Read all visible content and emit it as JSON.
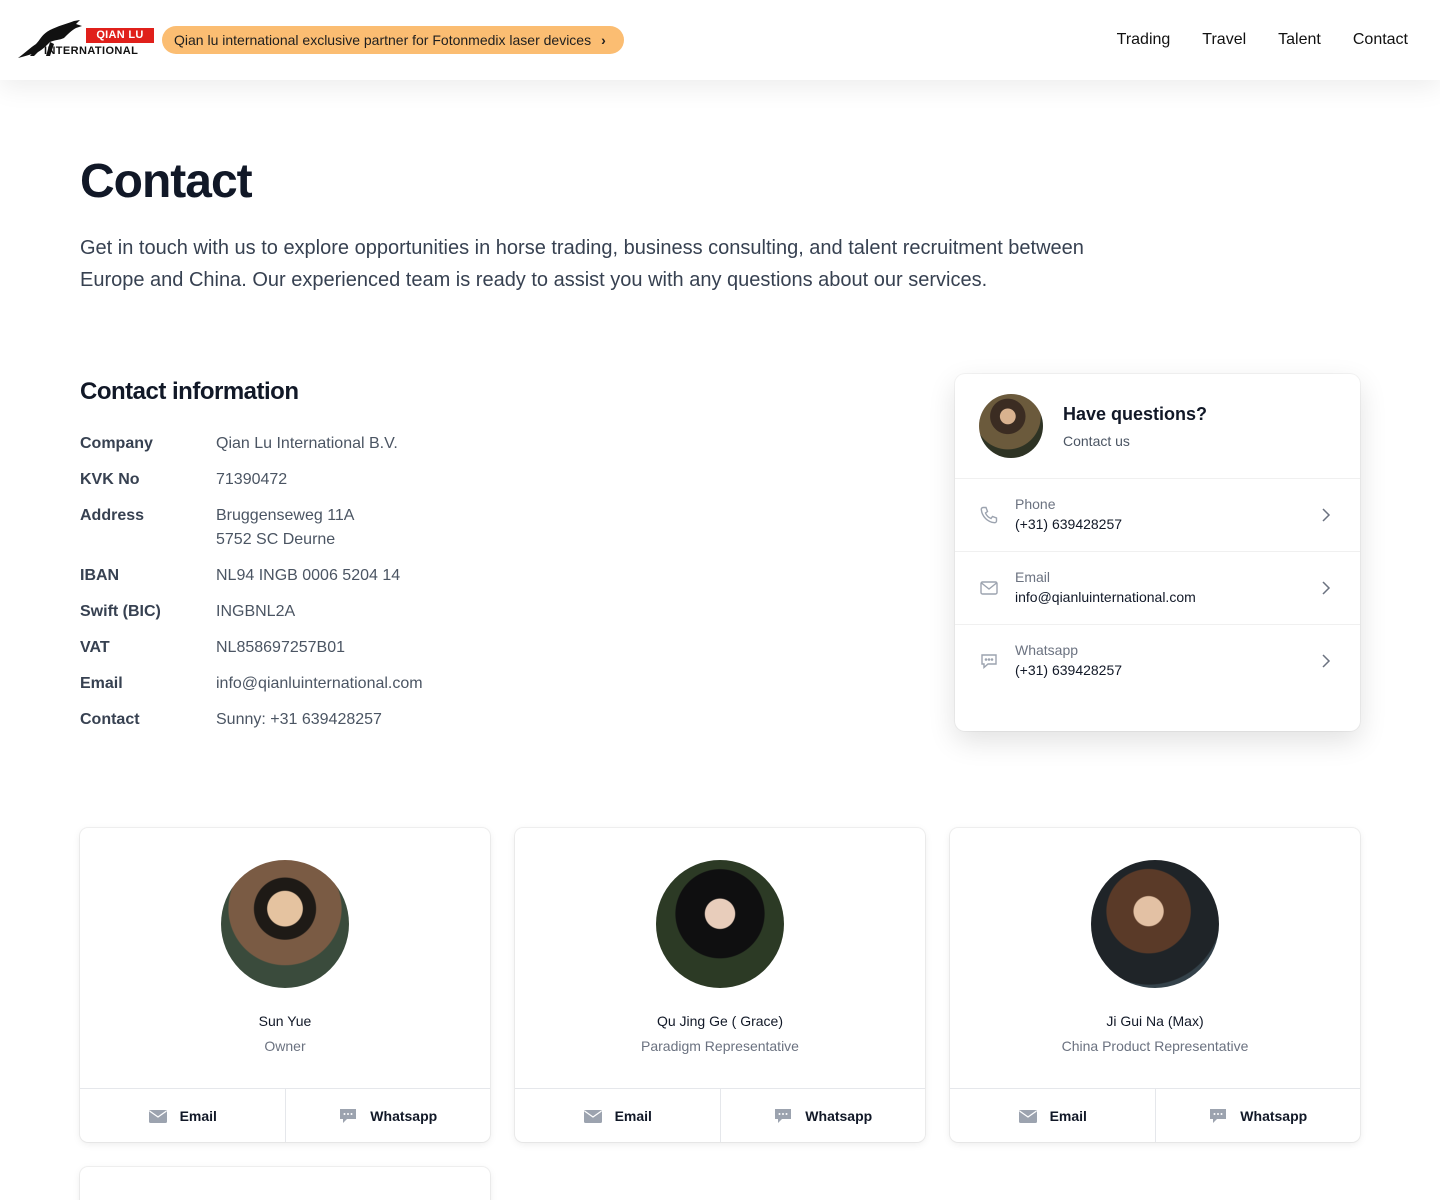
{
  "header": {
    "logo_top": "QIAN LU",
    "logo_bottom": "INTERNATIONAL",
    "promo": "Qian lu international exclusive partner for Fotonmedix laser devices",
    "nav": [
      "Trading",
      "Travel",
      "Talent",
      "Contact"
    ]
  },
  "hero": {
    "title": "Contact",
    "intro": "Get in touch with us to explore opportunities in horse trading, business consulting, and talent recruitment between Europe and China. Our experienced team is ready to assist you with any questions about our services."
  },
  "contact_info": {
    "title": "Contact information",
    "rows": [
      {
        "label": "Company",
        "value": "Qian Lu International B.V.",
        "value2": ""
      },
      {
        "label": "KVK No",
        "value": "71390472",
        "value2": ""
      },
      {
        "label": "Address",
        "value": "Bruggenseweg 11A",
        "value2": "5752 SC Deurne"
      },
      {
        "label": "IBAN",
        "value": "NL94 INGB 0006 5204 14",
        "value2": ""
      },
      {
        "label": "Swift (BIC)",
        "value": "INGBNL2A",
        "value2": ""
      },
      {
        "label": "VAT",
        "value": "NL858697257B01",
        "value2": ""
      },
      {
        "label": "Email",
        "value": "info@qianluinternational.com",
        "value2": ""
      },
      {
        "label": "Contact",
        "value": "Sunny: +31 639428257",
        "value2": ""
      }
    ]
  },
  "question_card": {
    "title": "Have questions?",
    "subtitle": "Contact us",
    "items": [
      {
        "icon": "phone-icon",
        "label": "Phone",
        "value": "(+31) 639428257"
      },
      {
        "icon": "mail-icon",
        "label": "Email",
        "value": "info@qianluinternational.com"
      },
      {
        "icon": "chat-icon",
        "label": "Whatsapp",
        "value": "(+31) 639428257"
      }
    ]
  },
  "team": [
    {
      "name": "Sun Yue",
      "role": "Owner",
      "email_label": "Email",
      "whatsapp_label": "Whatsapp"
    },
    {
      "name": "Qu Jing Ge ( Grace)",
      "role": "Paradigm Representative",
      "email_label": "Email",
      "whatsapp_label": "Whatsapp"
    },
    {
      "name": "Ji Gui Na (Max)",
      "role": "China Product Representative",
      "email_label": "Email",
      "whatsapp_label": "Whatsapp"
    }
  ],
  "colors": {
    "promo_bg": "#fbbd72",
    "logo_red": "#e0201b",
    "text_dark": "#111827",
    "text_muted": "#6b7280"
  }
}
